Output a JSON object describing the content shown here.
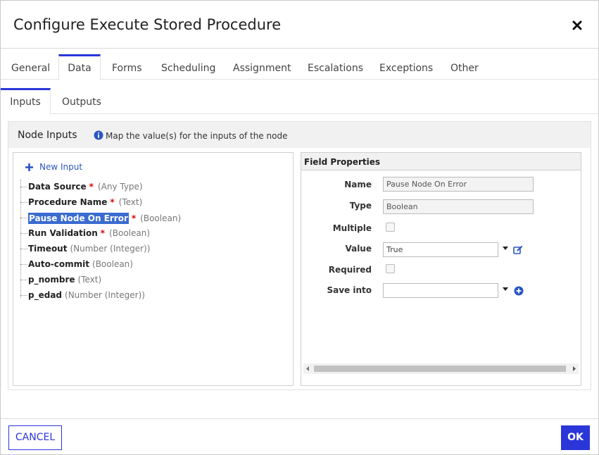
{
  "dialog": {
    "title": "Configure Execute Stored Procedure"
  },
  "tabs": [
    {
      "label": "General"
    },
    {
      "label": "Data"
    },
    {
      "label": "Forms"
    },
    {
      "label": "Scheduling"
    },
    {
      "label": "Assignment"
    },
    {
      "label": "Escalations"
    },
    {
      "label": "Exceptions"
    },
    {
      "label": "Other"
    }
  ],
  "active_tab": "Data",
  "subtabs": [
    {
      "label": "Inputs"
    },
    {
      "label": "Outputs"
    }
  ],
  "active_subtab": "Inputs",
  "section": {
    "title": "Node Inputs",
    "hint": "Map the value(s) for the inputs of the node"
  },
  "tree": {
    "new_input_label": "New Input",
    "items": [
      {
        "name": "Data Source",
        "required": "*",
        "type": "(Any Type)"
      },
      {
        "name": "Procedure Name",
        "required": "*",
        "type": "(Text)"
      },
      {
        "name": "Pause Node On Error",
        "required": "*",
        "type": "(Boolean)",
        "selected": true
      },
      {
        "name": "Run Validation",
        "required": "*",
        "type": "(Boolean)"
      },
      {
        "name": "Timeout",
        "required": "",
        "type": "(Number (Integer))"
      },
      {
        "name": "Auto-commit",
        "required": "",
        "type": "(Boolean)"
      },
      {
        "name": "p_nombre",
        "required": "",
        "type": "(Text)"
      },
      {
        "name": "p_edad",
        "required": "",
        "type": "(Number (Integer))"
      }
    ]
  },
  "field_properties": {
    "header": "Field Properties",
    "name_label": "Name",
    "name_value": "Pause Node On Error",
    "type_label": "Type",
    "type_value": "Boolean",
    "multiple_label": "Multiple",
    "multiple_checked": false,
    "value_label": "Value",
    "value_value": "True",
    "required_label": "Required",
    "required_checked": false,
    "save_into_label": "Save into",
    "save_into_value": ""
  },
  "footer": {
    "cancel_label": "CANCEL",
    "ok_label": "OK"
  },
  "colors": {
    "accent": "#2b36d9",
    "selection": "#3a6bd0",
    "required": "#dd0000",
    "link": "#2a55c2"
  },
  "icons": {
    "close": "close-icon",
    "info": "info-icon",
    "new_input": "plus-icon",
    "value_action": "edit-icon",
    "save_into_action": "add-circle-icon"
  }
}
